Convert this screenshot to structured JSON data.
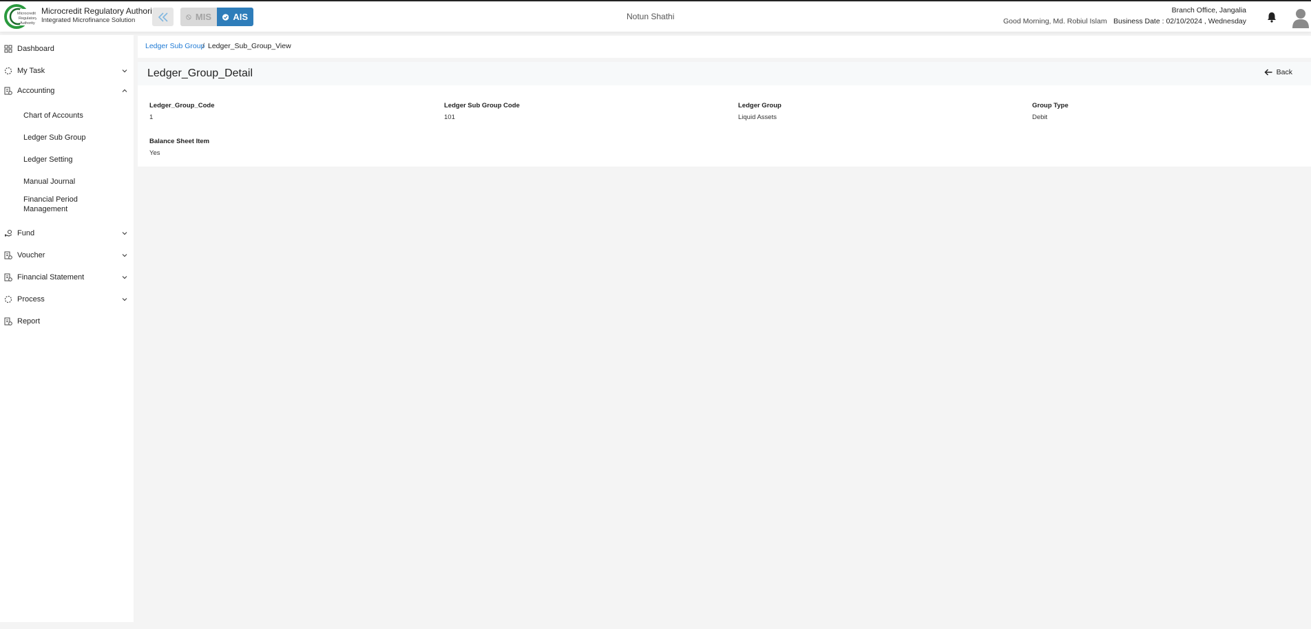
{
  "header": {
    "org_title": "Microcredit Regulatory Authority",
    "org_subtitle": "Integrated Microfinance Solution",
    "logo_text": "Microcredit Regulatory Authority",
    "modules": [
      {
        "label": "MIS",
        "active": false
      },
      {
        "label": "AIS",
        "active": true
      }
    ],
    "center_name": "Notun Shathi",
    "branch": "Branch Office, Jangalia",
    "greeting": "Good Morning, Md. Robiul Islam",
    "business_date": "Business Date : 02/10/2024 , Wednesday"
  },
  "sidebar": {
    "items": [
      {
        "label": "Dashboard",
        "icon": "grid-icon"
      },
      {
        "label": "My Task",
        "icon": "dashed-circle-icon",
        "expanded": false
      },
      {
        "label": "Accounting",
        "icon": "ledger-icon",
        "expanded": true
      },
      {
        "label": "Fund",
        "icon": "hand-coin-icon",
        "expanded": false
      },
      {
        "label": "Voucher",
        "icon": "ledger-icon",
        "expanded": false
      },
      {
        "label": "Financial Statement",
        "icon": "ledger-icon",
        "expanded": false
      },
      {
        "label": "Process",
        "icon": "dashed-circle-icon",
        "expanded": false
      },
      {
        "label": "Report",
        "icon": "ledger-icon"
      }
    ],
    "accounting_sub": [
      "Chart of Accounts",
      "Ledger Sub Group",
      "Ledger Setting",
      "Manual Journal",
      "Financial Period Management"
    ]
  },
  "breadcrumb": {
    "link": "Ledger Sub Group",
    "separator": "/",
    "current": "Ledger_Sub_Group_View"
  },
  "detail": {
    "title": "Ledger_Group_Detail",
    "back_label": "Back",
    "fields": [
      {
        "label": "Ledger_Group_Code",
        "value": "1"
      },
      {
        "label": "Ledger Sub Group Code",
        "value": "101"
      },
      {
        "label": "Ledger Group",
        "value": "Liquid Assets"
      },
      {
        "label": "Group Type",
        "value": "Debit"
      },
      {
        "label": "Balance Sheet Item",
        "value": "Yes"
      }
    ]
  },
  "colors": {
    "accent": "#2e7dba",
    "link": "#1f7ad4",
    "logo_green": "#2a9a3e"
  }
}
